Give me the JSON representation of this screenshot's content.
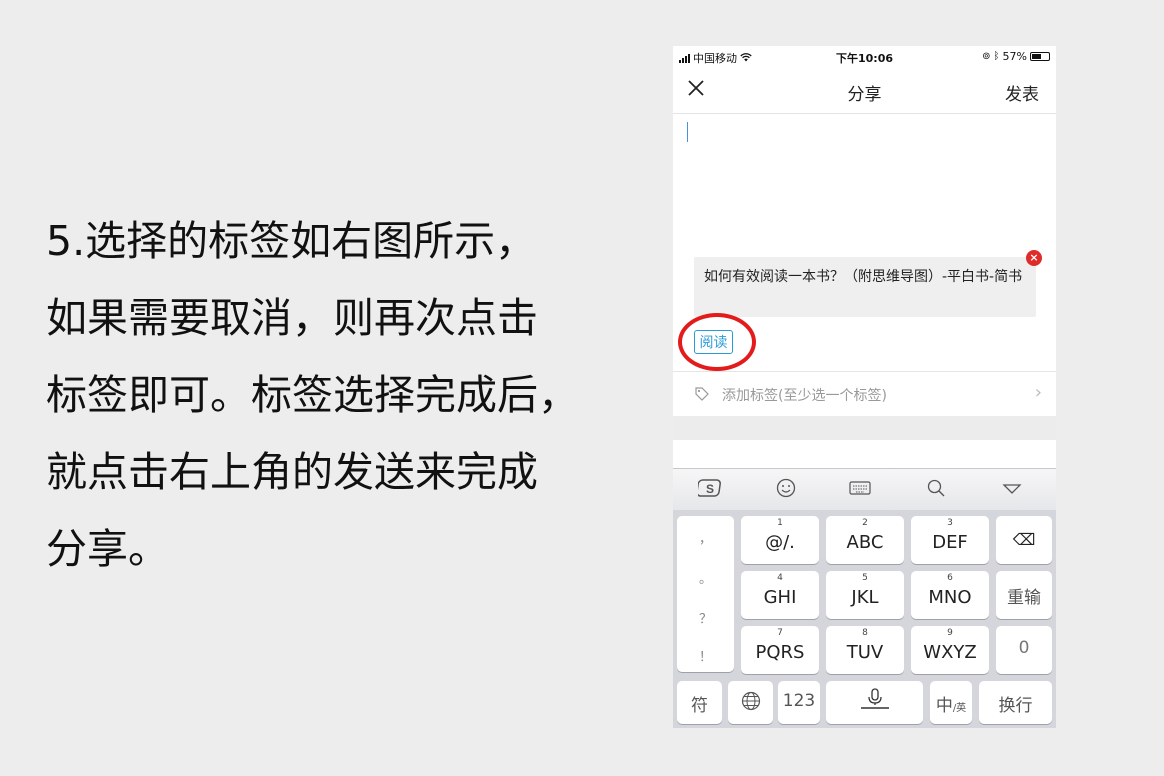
{
  "instruction": {
    "lines": [
      "5.选择的标签如右图所示，",
      "如果需要取消，则再次点击",
      "标签即可。标签选择完成后，",
      "就点击右上角的发送来完成",
      "分享。"
    ]
  },
  "status_bar": {
    "carrier": "中国移动",
    "time": "下午10:06",
    "battery": "57%",
    "battery_level": 0.57
  },
  "nav": {
    "close_icon": "close-x-icon",
    "title": "分享",
    "publish": "发表"
  },
  "share_card": {
    "text": "如何有效阅读一本书？（附思维导图）-平白书-简书",
    "remove_icon": "×"
  },
  "selected_tag": "阅读",
  "add_tag": {
    "label": "添加标签(至少选一个标签)",
    "chevron": "›"
  },
  "keyboard": {
    "toolbar": [
      "sogou-logo-icon",
      "emoji-icon",
      "keyboard-icon",
      "search-icon",
      "collapse-icon"
    ],
    "punct": [
      "，",
      "。",
      "？",
      "！"
    ],
    "rows": [
      [
        {
          "num": "1",
          "label": "@/."
        },
        {
          "num": "2",
          "label": "ABC"
        },
        {
          "num": "3",
          "label": "DEF"
        }
      ],
      [
        {
          "num": "4",
          "label": "GHI"
        },
        {
          "num": "5",
          "label": "JKL"
        },
        {
          "num": "6",
          "label": "MNO"
        }
      ],
      [
        {
          "num": "7",
          "label": "PQRS"
        },
        {
          "num": "8",
          "label": "TUV"
        },
        {
          "num": "9",
          "label": "WXYZ"
        }
      ]
    ],
    "backspace": "⌫",
    "reenter": "重输",
    "zero": "0",
    "symbols": "符",
    "globe": "🌐",
    "numbers": "123",
    "space_mic": "🎙",
    "lang": "中",
    "lang_sub": "/英",
    "enter": "换行"
  }
}
